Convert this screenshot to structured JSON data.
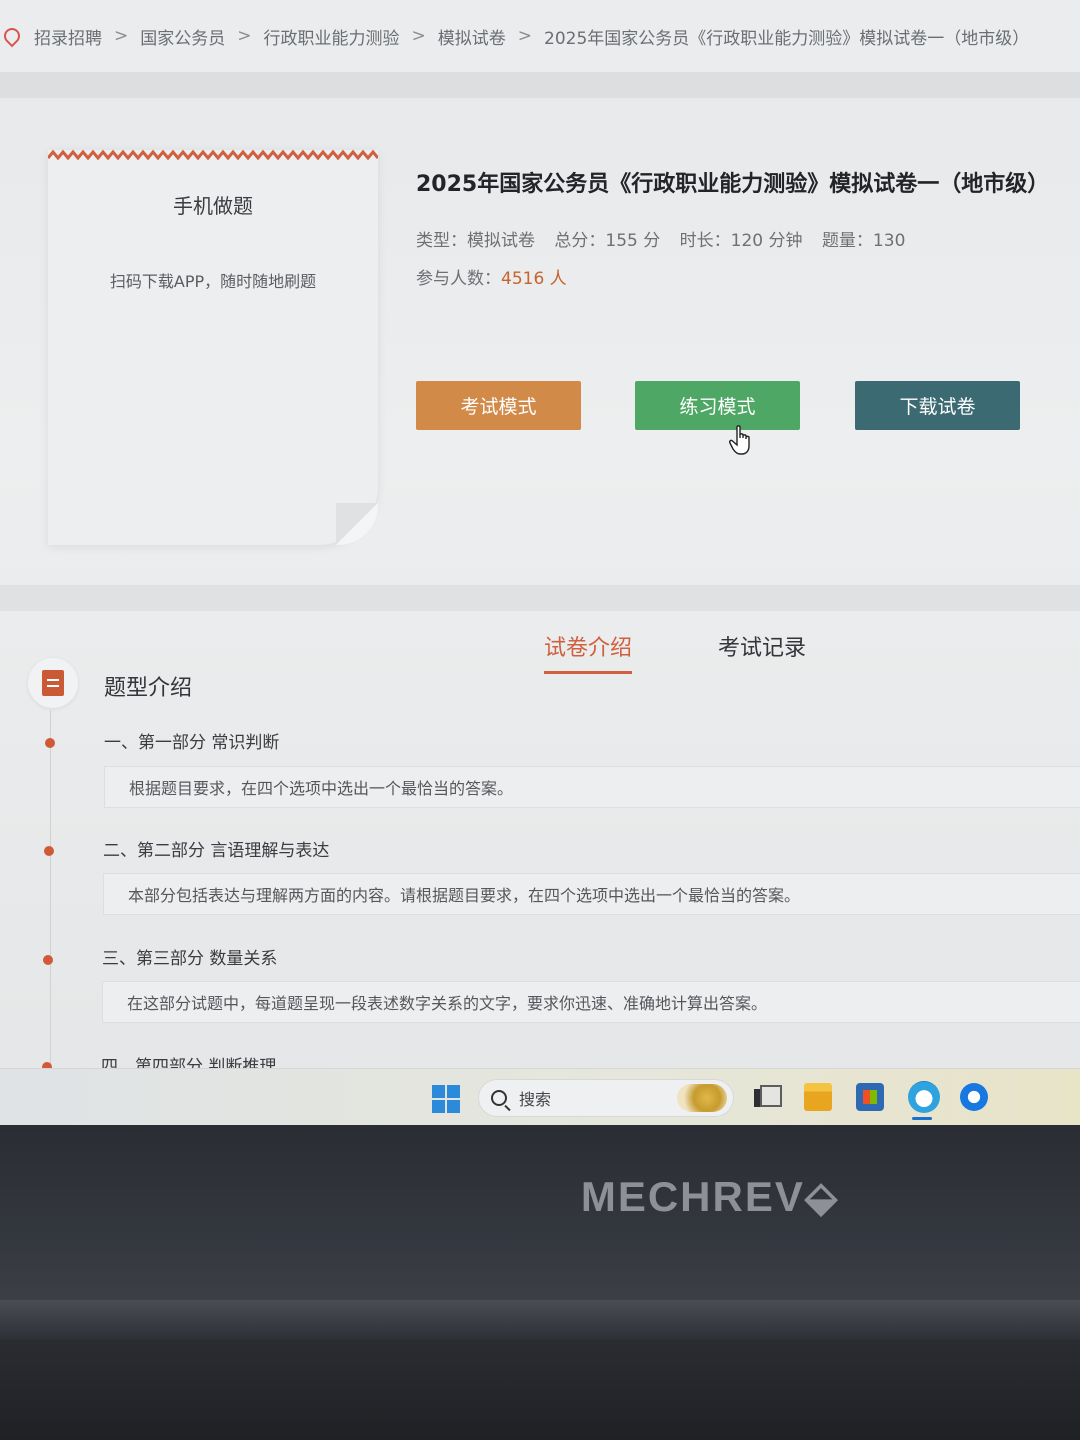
{
  "breadcrumb": {
    "items": [
      "招录招聘",
      "国家公务员",
      "行政职业能力测验",
      "模拟试卷"
    ],
    "separator": ">",
    "current": "2025年国家公务员《行政职业能力测验》模拟试卷一（地市级）"
  },
  "mobile_card": {
    "title": "手机做题",
    "subtitle": "扫码下载APP，随时随地刷题"
  },
  "exam": {
    "title": "2025年国家公务员《行政职业能力测验》模拟试卷一（地市级）",
    "type_label": "类型：模拟试卷",
    "score_label": "总分：155 分",
    "duration_label": "时长：120 分钟",
    "count_label": "题量：130",
    "participants_prefix": "参与人数：",
    "participants_value": "4516 人"
  },
  "buttons": {
    "exam_mode": "考试模式",
    "practice_mode": "练习模式",
    "download": "下载试卷"
  },
  "tabs": {
    "intro": "试卷介绍",
    "record": "考试记录",
    "active": "intro"
  },
  "section": {
    "title": "题型介绍",
    "parts": [
      {
        "title": "一、第一部分 常识判断",
        "desc": "根据题目要求，在四个选项中选出一个最恰当的答案。"
      },
      {
        "title": "二、第二部分 言语理解与表达",
        "desc": "本部分包括表达与理解两方面的内容。请根据题目要求，在四个选项中选出一个最恰当的答案。"
      },
      {
        "title": "三、第三部分 数量关系",
        "desc": "在这部分试题中，每道题呈现一段表述数字关系的文字，要求你迅速、准确地计算出答案。"
      },
      {
        "title": "四、第四部分 判断推理",
        "desc": ""
      }
    ]
  },
  "taskbar": {
    "search_placeholder": "搜索"
  },
  "laptop": {
    "brand": "MECHREV⬙"
  },
  "colors": {
    "accent": "#d0603e",
    "exam_btn": "#d28a48",
    "practice_btn": "#4fa765",
    "download_btn": "#3c6a72"
  },
  "icons": [
    "location-pin-icon",
    "document-list-icon",
    "hand-cursor-icon",
    "windows-start-icon",
    "search-icon",
    "task-view-icon",
    "file-explorer-icon",
    "store-icon",
    "edge-browser-icon",
    "app-icon"
  ]
}
